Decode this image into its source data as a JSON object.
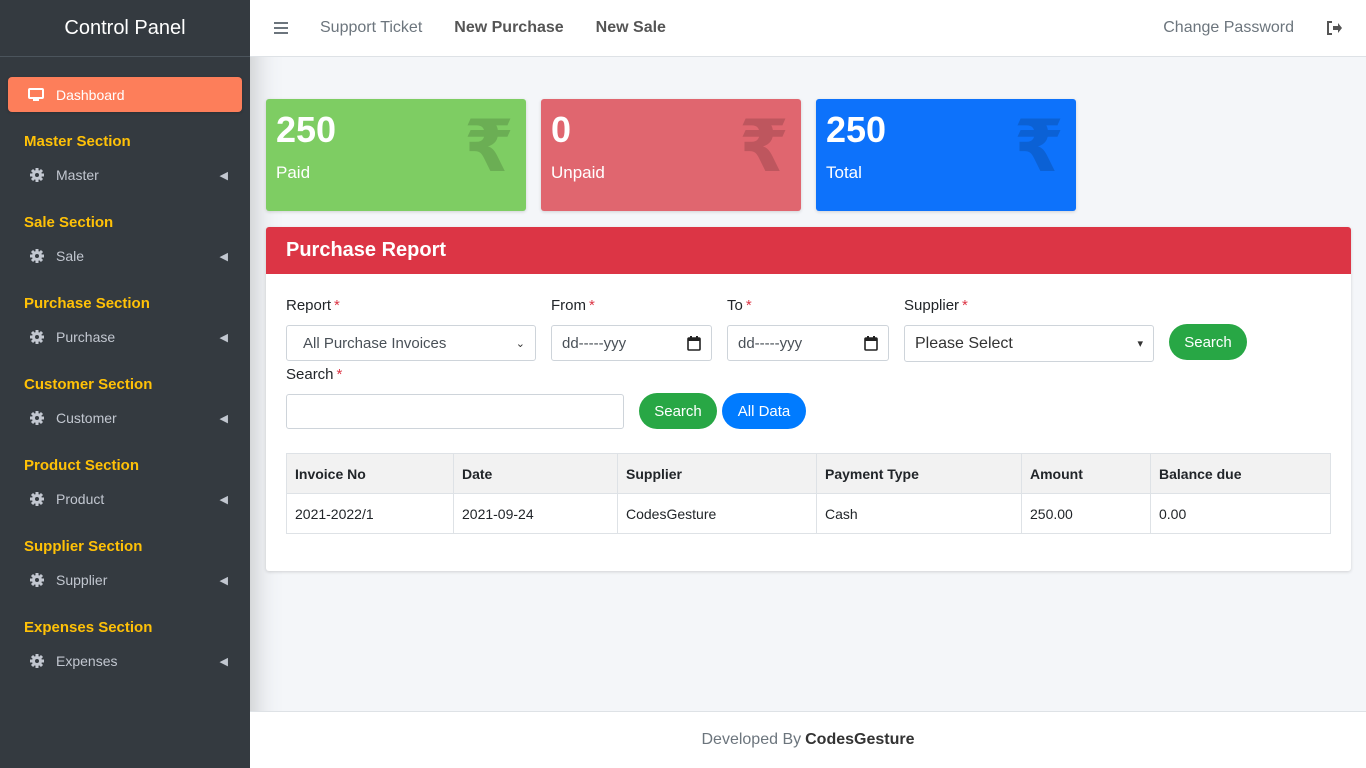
{
  "sidebar": {
    "brand": "Control Panel",
    "dashboard_label": "Dashboard",
    "sections": [
      {
        "header": "Master Section",
        "item": "Master"
      },
      {
        "header": "Sale Section",
        "item": "Sale"
      },
      {
        "header": "Purchase Section",
        "item": "Purchase"
      },
      {
        "header": "Customer Section",
        "item": "Customer"
      },
      {
        "header": "Product Section",
        "item": "Product"
      },
      {
        "header": "Supplier Section",
        "item": "Supplier"
      },
      {
        "header": "Expenses Section",
        "item": "Expenses"
      }
    ]
  },
  "navbar": {
    "links": [
      "Support Ticket",
      "New Purchase",
      "New Sale"
    ],
    "change_password": "Change Password"
  },
  "stats": [
    {
      "value": "250",
      "label": "Paid",
      "icon": "rupee-icon",
      "color": "#7ecd63"
    },
    {
      "value": "0",
      "label": "Unpaid",
      "icon": "rupee-icon",
      "color": "#e0666f"
    },
    {
      "value": "250",
      "label": "Total",
      "icon": "rupee-icon",
      "color": "#0d72fb"
    }
  ],
  "report": {
    "title": "Purchase Report",
    "report_label": "Report",
    "report_value": "All Purchase Invoices",
    "from_label": "From",
    "from_placeholder": "dd-----yyy",
    "to_label": "To",
    "to_placeholder": "dd-----yyy",
    "supplier_label": "Supplier",
    "supplier_value": "Please Select",
    "search_button": "Search",
    "search_label": "Search",
    "search_value": "",
    "search_button2": "Search",
    "all_data_button": "All Data",
    "required_mark": "*"
  },
  "table": {
    "headers": [
      "Invoice No",
      "Date",
      "Supplier",
      "Payment Type",
      "Amount",
      "Balance due"
    ],
    "rows": [
      [
        "2021-2022/1",
        "2021-09-24",
        "CodesGesture",
        "Cash",
        "250.00",
        "0.00"
      ]
    ]
  },
  "footer": {
    "prefix": "Developed By",
    "brand": "CodesGesture"
  },
  "colors": {
    "sidebar_bg": "#343a40",
    "accent_orange": "#fd7e5a",
    "section_yellow": "#ffc107",
    "header_red": "#dc3545",
    "button_green": "#28a745",
    "button_blue": "#007bff"
  }
}
